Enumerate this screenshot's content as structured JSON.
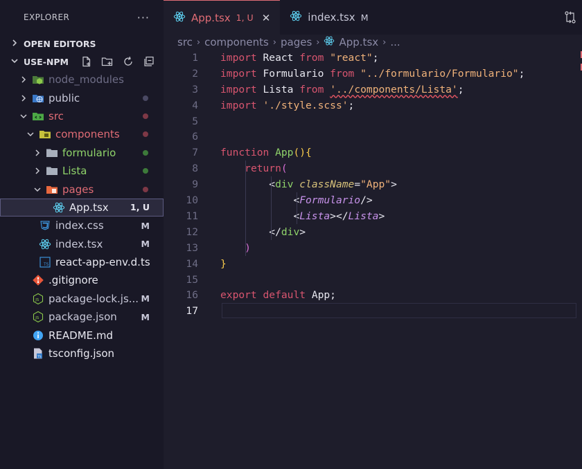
{
  "explorer": {
    "title": "EXPLORER",
    "more": "···",
    "open_editors": "OPEN EDITORS",
    "project": "USE-NPM"
  },
  "tree": [
    {
      "label": "node_modules",
      "color": "#6e6d86",
      "icon": "node-folder-icon",
      "depth": 1,
      "twisty": "closed",
      "status": ""
    },
    {
      "label": "public",
      "color": "#c8c8d8",
      "icon": "globe-folder-icon",
      "depth": 1,
      "twisty": "closed",
      "dot": "#4a4963"
    },
    {
      "label": "src",
      "color": "#e06c75",
      "icon": "src-folder-icon",
      "depth": 1,
      "twisty": "open",
      "dot": "#7d3846"
    },
    {
      "label": "components",
      "color": "#e06c75",
      "icon": "components-folder-icon",
      "depth": 2,
      "twisty": "open",
      "dot": "#7d3846"
    },
    {
      "label": "formulario",
      "color": "#8fd36a",
      "icon": "folder-icon",
      "depth": 3,
      "twisty": "closed",
      "dot": "#3d7a3a"
    },
    {
      "label": "Lista",
      "color": "#8fd36a",
      "icon": "folder-icon",
      "depth": 3,
      "twisty": "closed",
      "dot": "#3d7a3a"
    },
    {
      "label": "pages",
      "color": "#e06c75",
      "icon": "pages-folder-icon",
      "depth": 3,
      "twisty": "open",
      "dot": "#7d3846"
    },
    {
      "label": "App.tsx",
      "color": "#e8e8f0",
      "icon": "react-icon",
      "depth": 4,
      "twisty": "none",
      "status": "1, U",
      "statusColor": "#e8e8f0",
      "selected": true
    },
    {
      "label": "index.css",
      "color": "#c8c8d8",
      "icon": "css-icon",
      "depth": 2,
      "twisty": "none",
      "status": "M",
      "statusColor": "#c8c8d8"
    },
    {
      "label": "index.tsx",
      "color": "#c8c8d8",
      "icon": "react-icon",
      "depth": 2,
      "twisty": "none",
      "status": "M",
      "statusColor": "#c8c8d8"
    },
    {
      "label": "react-app-env.d.ts",
      "color": "#e8e8f0",
      "icon": "ts-icon",
      "depth": 2,
      "twisty": "none"
    },
    {
      "label": ".gitignore",
      "color": "#e8e8f0",
      "icon": "git-icon",
      "depth": 1,
      "twisty": "none"
    },
    {
      "label": "package-lock.js...",
      "color": "#c8c8d8",
      "icon": "js-icon",
      "depth": 1,
      "twisty": "none",
      "status": "M",
      "statusColor": "#c8c8d8"
    },
    {
      "label": "package.json",
      "color": "#c8c8d8",
      "icon": "js-icon",
      "depth": 1,
      "twisty": "none",
      "status": "M",
      "statusColor": "#c8c8d8"
    },
    {
      "label": "README.md",
      "color": "#e8e8f0",
      "icon": "info-icon",
      "depth": 1,
      "twisty": "none"
    },
    {
      "label": "tsconfig.json",
      "color": "#e8e8f0",
      "icon": "tsconfig-icon",
      "depth": 1,
      "twisty": "none"
    }
  ],
  "tabs": [
    {
      "label": "App.tsx",
      "status": "1, U",
      "active": true,
      "color": "#e06c75",
      "close": "✕"
    },
    {
      "label": "index.tsx",
      "status": "M",
      "active": false,
      "color": "#c8c8d8"
    }
  ],
  "breadcrumb": [
    "src",
    "components",
    "pages",
    "App.tsx",
    "..."
  ],
  "editor": {
    "active_line": 17,
    "lines": [
      [
        [
          "k",
          "import"
        ],
        [
          "pl",
          " React "
        ],
        [
          "k",
          "from"
        ],
        [
          "pl",
          " "
        ],
        [
          "s",
          "\"react\""
        ],
        [
          "pn",
          ";"
        ]
      ],
      [
        [
          "k",
          "import"
        ],
        [
          "pl",
          " Formulario "
        ],
        [
          "k",
          "from"
        ],
        [
          "pl",
          " "
        ],
        [
          "s",
          "\"../formulario/Formulario\""
        ],
        [
          "pn",
          ";"
        ]
      ],
      [
        [
          "k",
          "import"
        ],
        [
          "pl",
          " Lista "
        ],
        [
          "k",
          "from"
        ],
        [
          "pl",
          " "
        ],
        [
          "s squig",
          "'../components/Lista'"
        ],
        [
          "pn",
          ";"
        ]
      ],
      [
        [
          "k",
          "import"
        ],
        [
          "pl",
          " "
        ],
        [
          "s",
          "'./style.scss'"
        ],
        [
          "pn",
          ";"
        ]
      ],
      [],
      [],
      [
        [
          "k",
          "function"
        ],
        [
          "pl",
          " "
        ],
        [
          "fn",
          "App"
        ],
        [
          "br1",
          "()"
        ],
        [
          "br1",
          "{"
        ]
      ],
      [
        [
          "pl",
          "    "
        ],
        [
          "k",
          "return"
        ],
        [
          "br2",
          "("
        ]
      ],
      [
        [
          "pl",
          "        "
        ],
        [
          "pn",
          "<"
        ],
        [
          "tg",
          "div"
        ],
        [
          "pl",
          " "
        ],
        [
          "at",
          "className"
        ],
        [
          "pn",
          "="
        ],
        [
          "s",
          "\"App\""
        ],
        [
          "pn",
          ">"
        ]
      ],
      [
        [
          "pl",
          "            "
        ],
        [
          "pn",
          "<"
        ],
        [
          "cm",
          "Formulario"
        ],
        [
          "pn",
          "/>"
        ]
      ],
      [
        [
          "pl",
          "            "
        ],
        [
          "pn",
          "<"
        ],
        [
          "cm",
          "Lista"
        ],
        [
          "pn",
          "></"
        ],
        [
          "cm",
          "Lista"
        ],
        [
          "pn",
          ">"
        ]
      ],
      [
        [
          "pl",
          "        "
        ],
        [
          "pn",
          "</"
        ],
        [
          "tg",
          "div"
        ],
        [
          "pn",
          ">"
        ]
      ],
      [
        [
          "pl",
          "    "
        ],
        [
          "br2",
          ")"
        ]
      ],
      [
        [
          "br1",
          "}"
        ]
      ],
      [],
      [
        [
          "k",
          "export"
        ],
        [
          "pl",
          " "
        ],
        [
          "k",
          "default"
        ],
        [
          "pl",
          " App;"
        ]
      ],
      []
    ]
  }
}
